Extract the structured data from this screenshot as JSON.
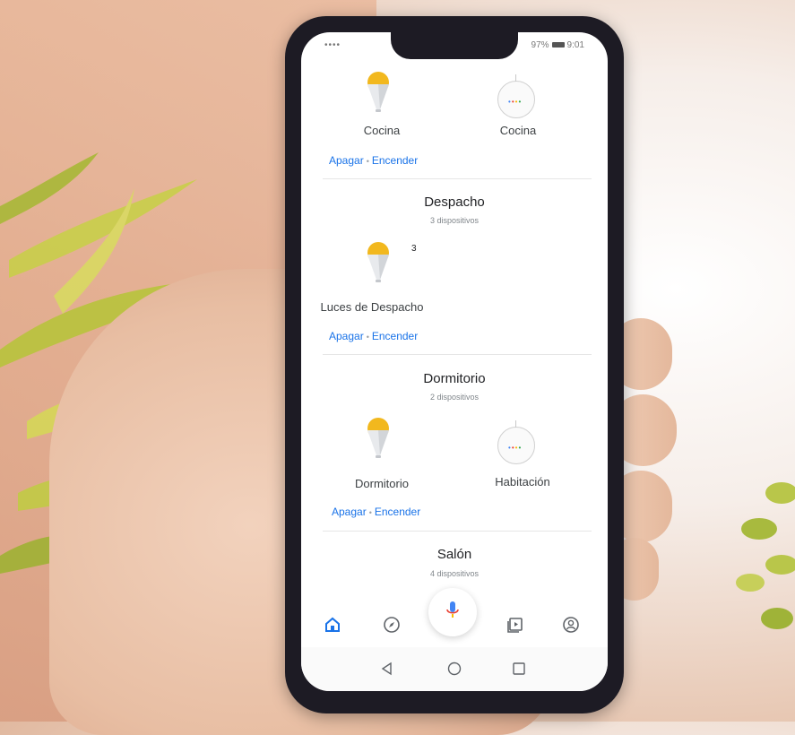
{
  "status_bar": {
    "left": "••••",
    "battery": "97%",
    "time": "9:01"
  },
  "top_section": {
    "devices": [
      {
        "name": "Cocina",
        "icon": "light-bulb-icon"
      },
      {
        "name": "Cocina",
        "icon": "smart-speaker-icon"
      }
    ],
    "off_label": "Apagar",
    "on_label": "Encender"
  },
  "rooms": [
    {
      "title": "Despacho",
      "subtitle": "3 dispositivos",
      "devices": [
        {
          "name": "Luces de Despacho",
          "icon": "light-bulb-icon",
          "badge": "3"
        }
      ],
      "off_label": "Apagar",
      "on_label": "Encender"
    },
    {
      "title": "Dormitorio",
      "subtitle": "2 dispositivos",
      "devices": [
        {
          "name": "Dormitorio",
          "icon": "light-bulb-icon"
        },
        {
          "name": "Habitación",
          "icon": "smart-speaker-icon"
        }
      ],
      "off_label": "Apagar",
      "on_label": "Encender"
    },
    {
      "title": "Salón",
      "subtitle": "4 dispositivos"
    }
  ],
  "bottom_nav": [
    {
      "icon": "home-icon",
      "active": true
    },
    {
      "icon": "compass-icon"
    },
    {
      "icon": "microphone-icon"
    },
    {
      "icon": "media-icon"
    },
    {
      "icon": "account-icon"
    }
  ],
  "system_nav": [
    {
      "icon": "back-icon"
    },
    {
      "icon": "home-circle-icon"
    },
    {
      "icon": "recents-icon"
    }
  ],
  "colors": {
    "accent": "#1a73e8",
    "bulb": "#f2b81e",
    "background": "#ffffff"
  }
}
